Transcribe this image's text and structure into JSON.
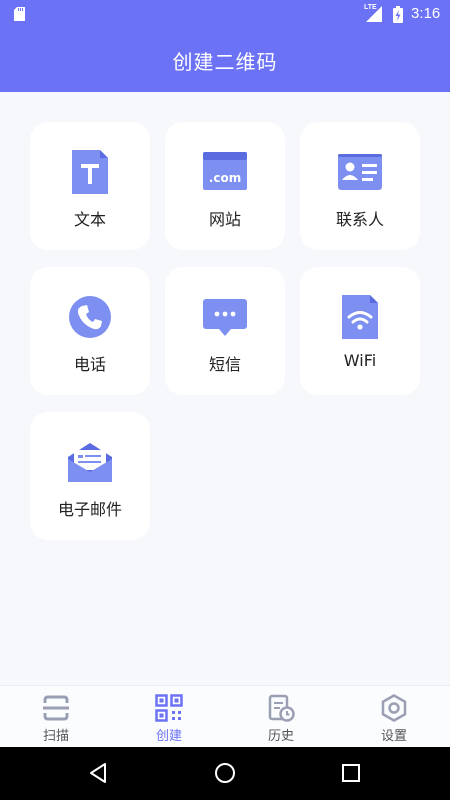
{
  "status_bar": {
    "network": "LTE",
    "time": "3:16"
  },
  "app_bar": {
    "title": "创建二维码"
  },
  "create_options": [
    {
      "label": "文本",
      "icon": "text-file-icon"
    },
    {
      "label": "网站",
      "icon": "website-icon",
      "icon_text": ".com"
    },
    {
      "label": "联系人",
      "icon": "contact-card-icon"
    },
    {
      "label": "电话",
      "icon": "phone-icon"
    },
    {
      "label": "短信",
      "icon": "sms-icon"
    },
    {
      "label": "WiFi",
      "icon": "wifi-file-icon"
    },
    {
      "label": "电子邮件",
      "icon": "email-icon"
    }
  ],
  "bottom_nav": {
    "items": [
      {
        "label": "扫描",
        "icon": "scan-icon",
        "active": false
      },
      {
        "label": "创建",
        "icon": "qr-code-icon",
        "active": true
      },
      {
        "label": "历史",
        "icon": "history-icon",
        "active": false
      },
      {
        "label": "设置",
        "icon": "settings-icon",
        "active": false
      }
    ]
  },
  "colors": {
    "primary": "#6b72f5",
    "icon_blue": "#7d8ff0",
    "icon_dark": "#5a6ce0",
    "nav_inactive": "#9a9fb3",
    "background": "#f7f8fc"
  }
}
